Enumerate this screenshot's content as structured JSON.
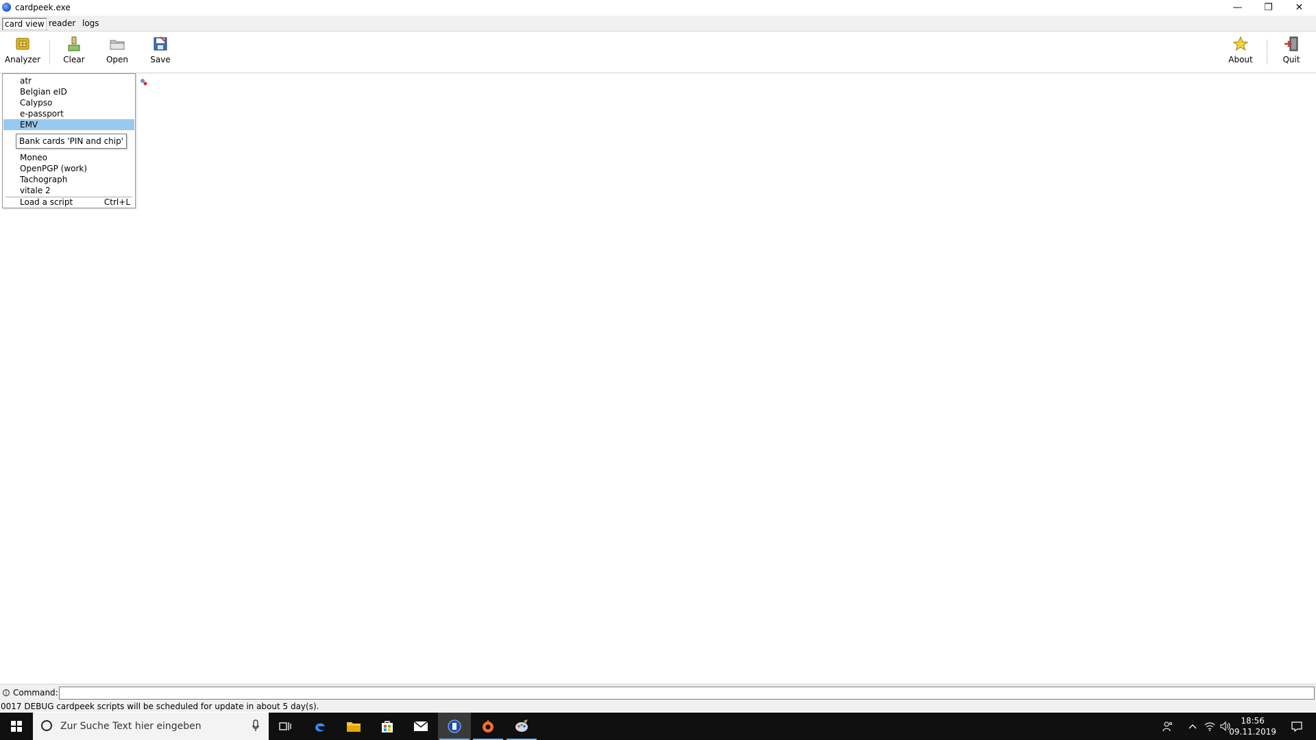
{
  "window": {
    "title": "cardpeek.exe",
    "minimize": "—",
    "maximize": "❐",
    "close": "✕"
  },
  "tabs": [
    {
      "label": "card view",
      "active": true
    },
    {
      "label": "reader",
      "active": false
    },
    {
      "label": "logs",
      "active": false
    }
  ],
  "toolbar": {
    "analyzer": "Analyzer",
    "clear": "Clear",
    "open": "Open",
    "save": "Save",
    "about": "About",
    "quit": "Quit"
  },
  "menu": {
    "items": [
      {
        "label": "atr"
      },
      {
        "label": "Belgian eID"
      },
      {
        "label": "Calypso"
      },
      {
        "label": "e-passport"
      },
      {
        "label": "EMV",
        "selected": true
      },
      {
        "label": "Moneo"
      },
      {
        "label": "OpenPGP (work)"
      },
      {
        "label": "Tachograph"
      },
      {
        "label": "vitale 2"
      }
    ],
    "load_script": {
      "label": "Load a script",
      "shortcut": "Ctrl+L"
    },
    "tooltip": "Bank cards 'PIN and chip'"
  },
  "command": {
    "label": "Command:",
    "value": ""
  },
  "status": {
    "text": "0017 DEBUG   cardpeek scripts will be scheduled for update in about 5 day(s)."
  },
  "taskbar": {
    "search_placeholder": "Zur Suche Text hier eingeben",
    "time": "18:56",
    "date": "09.11.2019"
  }
}
